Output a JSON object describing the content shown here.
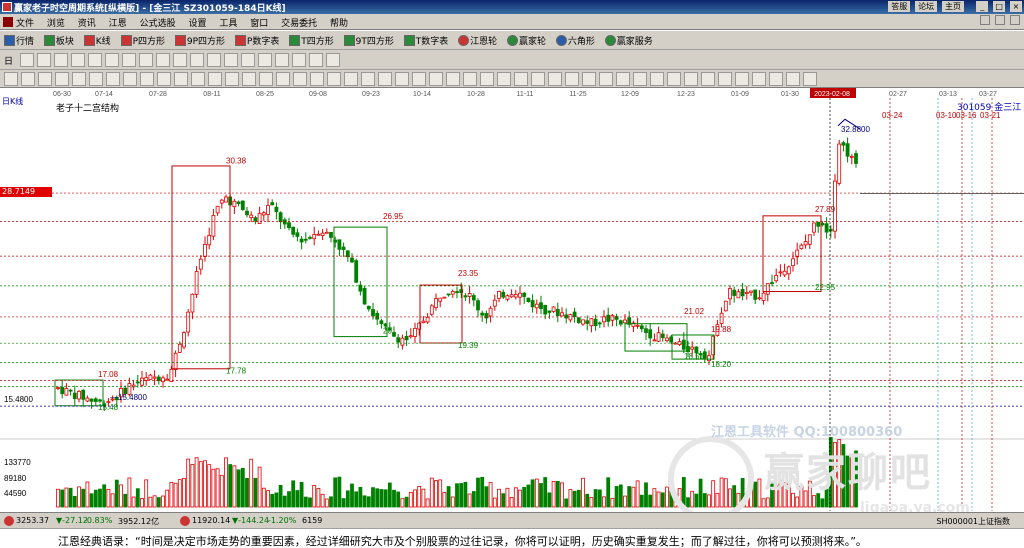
{
  "window": {
    "title": "赢家老子时空周期系统[纵横版] - [金三江   SZ301059-184日K线]",
    "links": [
      "答服",
      "论坛",
      "主页"
    ],
    "buttons": [
      "_",
      "□",
      "×"
    ]
  },
  "menu": {
    "items": [
      "文件",
      "浏览",
      "资讯",
      "江恩",
      "公式选股",
      "设置",
      "工具",
      "窗口",
      "交易委托",
      "帮助"
    ]
  },
  "toolbar": {
    "items": [
      {
        "label": "行情",
        "icon": "quote-icon"
      },
      {
        "label": "板块",
        "icon": "sector-icon"
      },
      {
        "label": "K线",
        "icon": "kline-icon"
      },
      {
        "label": "P四方形",
        "icon": "p-square-icon"
      },
      {
        "label": "9P四方形",
        "icon": "9p-square-icon"
      },
      {
        "label": "P数字表",
        "icon": "p-number-table-icon"
      },
      {
        "label": "T四方形",
        "icon": "t-square-icon"
      },
      {
        "label": "9T四方形",
        "icon": "9t-square-icon"
      },
      {
        "label": "T数字表",
        "icon": "t-number-table-icon"
      },
      {
        "label": "江恩轮",
        "icon": "gann-wheel-icon"
      },
      {
        "label": "赢家轮",
        "icon": "winner-wheel-icon"
      },
      {
        "label": "六角形",
        "icon": "hexagon-icon"
      },
      {
        "label": "赢家服务",
        "icon": "service-icon"
      }
    ],
    "period_label": "日"
  },
  "chart": {
    "kline_label": "日K线",
    "structure_label": "老子十二宫结构",
    "stock_code": "301059",
    "stock_name": "金三江",
    "current_price_tag": "28.7149",
    "left_axis": {
      "top_label": "15.4800",
      "vol_labels": [
        "133770",
        "89180",
        "44590"
      ]
    },
    "date_ticks": [
      "06-30",
      "07-14",
      "07-28",
      "08-11",
      "08-25",
      "09-08",
      "09-23",
      "10-14",
      "10-28",
      "11-11",
      "11-25",
      "12-09",
      "12-23",
      "01-09",
      "01-30",
      "2023-02-08",
      "02-27",
      "03-13",
      "03-27"
    ],
    "price_labels": [
      "30.38",
      "17.78",
      "26.95",
      "23.35",
      "19.39",
      "20",
      "17.08",
      "15.48",
      "15.4800",
      "21.02",
      "19.88",
      "18.51",
      "18.20",
      "27.89",
      "22.95",
      "32.8800"
    ],
    "future_dates": [
      "03-24",
      "03-10",
      "03-16",
      "03-21"
    ]
  },
  "chart_data": {
    "type": "candlestick",
    "y_range": [
      13.5,
      34
    ],
    "label_colors": {
      "up": "#e00000",
      "down": "#008000",
      "neutral": "#0000c0"
    }
  },
  "watermark": {
    "tool": "江恩工具软件  QQ:100800360",
    "main": "赢家聊吧",
    "url": "ligaoa.ya.com"
  },
  "status": {
    "sh_index": "3253.37",
    "sh_change": "▼-27.12",
    "sh_pct": "-0.83%",
    "sh_volume": "3952.12亿",
    "sz_index": "11920.14",
    "sz_change": "▼-144.24",
    "sz_pct": "-1.20%",
    "sz_volume": "6159",
    "right_label": "SH000001上证指数"
  },
  "quote": {
    "text": "江恩经典语录：“时间是决定市场走势的重要因素，经过详细研究大市及个别股票的过往记录，你将可以证明，历史确实重复发生；而了解过往，你将可以预测将来。”。"
  }
}
